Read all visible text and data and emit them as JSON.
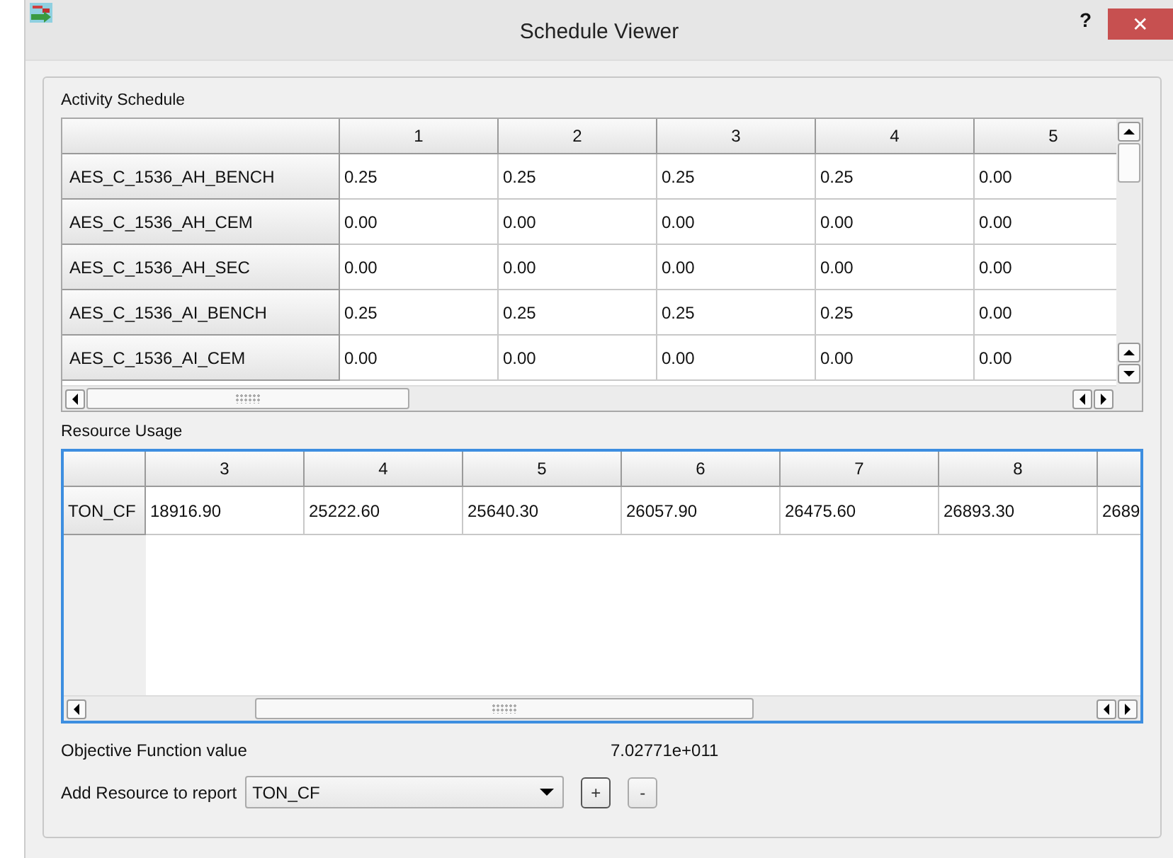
{
  "window": {
    "title": "Schedule Viewer",
    "help": "?",
    "close": "✕"
  },
  "activity_schedule": {
    "title": "Activity Schedule",
    "columns": [
      "1",
      "2",
      "3",
      "4",
      "5"
    ],
    "rows": [
      {
        "name": "AES_C_1536_AH_BENCH",
        "values": [
          "0.25",
          "0.25",
          "0.25",
          "0.25",
          "0.00"
        ]
      },
      {
        "name": "AES_C_1536_AH_CEM",
        "values": [
          "0.00",
          "0.00",
          "0.00",
          "0.00",
          "0.00"
        ]
      },
      {
        "name": "AES_C_1536_AH_SEC",
        "values": [
          "0.00",
          "0.00",
          "0.00",
          "0.00",
          "0.00"
        ]
      },
      {
        "name": "AES_C_1536_AI_BENCH",
        "values": [
          "0.25",
          "0.25",
          "0.25",
          "0.25",
          "0.00"
        ]
      },
      {
        "name": "AES_C_1536_AI_CEM",
        "values": [
          "0.00",
          "0.00",
          "0.00",
          "0.00",
          "0.00"
        ]
      }
    ]
  },
  "resource_usage": {
    "title": "Resource Usage",
    "columns": [
      "3",
      "4",
      "5",
      "6",
      "7",
      "8"
    ],
    "rows": [
      {
        "name": "TON_CF",
        "values": [
          "18916.90",
          "25222.60",
          "25640.30",
          "26057.90",
          "26475.60",
          "26893.30",
          "2689"
        ]
      }
    ]
  },
  "objective": {
    "label": "Objective Function value",
    "value": "7.02771e+011"
  },
  "add_resource": {
    "label": "Add Resource to report",
    "value": "TON_CF",
    "buttons": [
      "+",
      "-"
    ]
  }
}
